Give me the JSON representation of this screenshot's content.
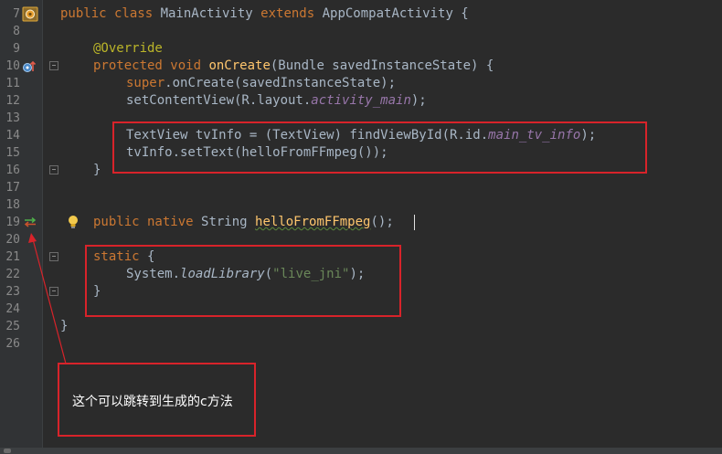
{
  "gutter": {
    "line_numbers": [
      "7",
      "8",
      "9",
      "10",
      "11",
      "12",
      "13",
      "14",
      "15",
      "16",
      "17",
      "18",
      "19",
      "20",
      "21",
      "22",
      "23",
      "24",
      "25",
      "26"
    ]
  },
  "code": {
    "l7": {
      "kw1": "public class ",
      "name": "MainActivity ",
      "kw2": "extends ",
      "parent": "AppCompatActivity {"
    },
    "l9": {
      "annotation": "@Override"
    },
    "l10": {
      "kw": "protected void ",
      "method": "onCreate",
      "params": "(Bundle savedInstanceState) {"
    },
    "l11": {
      "kw": "super",
      "rest": ".onCreate(savedInstanceState);"
    },
    "l12": {
      "call": "setContentView(R.layout.",
      "field": "activity_main",
      "end": ");"
    },
    "l14": {
      "decl": "TextView tvInfo = (TextView) findViewById(R.id.",
      "field": "main_tv_info",
      "end": ");"
    },
    "l15": {
      "text": "tvInfo.setText(helloFromFFmpeg());"
    },
    "l16": {
      "text": "}"
    },
    "l19": {
      "kw": "public native ",
      "type": "String ",
      "method": "helloFromFFmpeg",
      "end": "();"
    },
    "l21": {
      "kw": "static",
      "rest": " {"
    },
    "l22": {
      "obj": "System.",
      "method": "loadLibrary",
      "open": "(",
      "str": "\"live_jni\"",
      "end": ");"
    },
    "l23": {
      "text": "}"
    },
    "l25": {
      "text": "}"
    }
  },
  "annotation": {
    "note": "这个可以跳转到生成的c方法"
  },
  "colors": {
    "background": "#2b2b2b",
    "gutter": "#313335",
    "keyword": "#cc7832",
    "method_decl": "#ffc66d",
    "field": "#9876aa",
    "string": "#6a8759",
    "annotation": "#bbb529",
    "highlight_box": "#d8232a"
  },
  "icons": [
    "class-file-icon",
    "override-method-icon",
    "jni-navigate-icon",
    "lightbulb-icon",
    "fold-marker-icon"
  ]
}
